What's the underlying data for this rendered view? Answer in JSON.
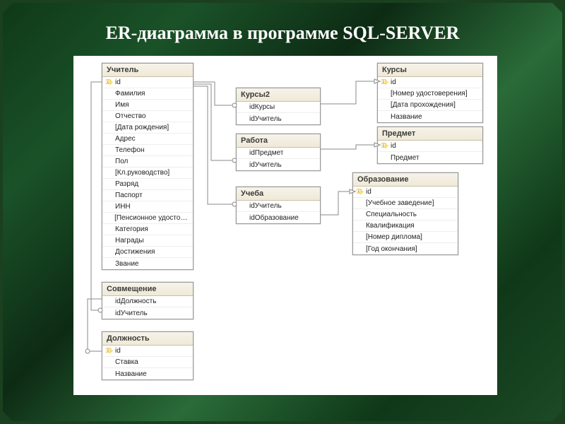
{
  "slide": {
    "title": "ER-диаграмма в программе SQL-SERVER"
  },
  "entities": {
    "teacher": {
      "title": "Учитель",
      "cols": [
        "id",
        "Фамилия",
        "Имя",
        "Отчество",
        "[Дата рождения]",
        "Адрес",
        "Телефон",
        "Пол",
        "[Кл.руководство]",
        "Разряд",
        "Паспорт",
        "ИНН",
        "[Пенсионное удостовер...",
        "Категория",
        "Награды",
        "Достижения",
        "Звание"
      ],
      "pk": [
        0
      ]
    },
    "sovm": {
      "title": "Совмещение",
      "cols": [
        "idДолжность",
        "idУчитель"
      ],
      "pk": []
    },
    "dolzh": {
      "title": "Должность",
      "cols": [
        "id",
        "Ставка",
        "Название"
      ],
      "pk": [
        0
      ]
    },
    "kursy2": {
      "title": "Курсы2",
      "cols": [
        "idКурсы",
        "idУчитель"
      ],
      "pk": []
    },
    "rabota": {
      "title": "Работа",
      "cols": [
        "idПредмет",
        "idУчитель"
      ],
      "pk": []
    },
    "ucheba": {
      "title": "Учеба",
      "cols": [
        "idУчитель",
        "idОбразование"
      ],
      "pk": []
    },
    "kursy": {
      "title": "Курсы",
      "cols": [
        "id",
        "[Номер удостоверения]",
        "[Дата прохождения]",
        "Название"
      ],
      "pk": [
        0
      ]
    },
    "predmet": {
      "title": "Предмет",
      "cols": [
        "id",
        "Предмет"
      ],
      "pk": [
        0
      ]
    },
    "obraz": {
      "title": "Образование",
      "cols": [
        "id",
        "[Учебное заведение]",
        "Специальность",
        "Квалификация",
        "[Номер диплома]",
        "[Год окончания]"
      ],
      "pk": [
        0
      ]
    }
  }
}
